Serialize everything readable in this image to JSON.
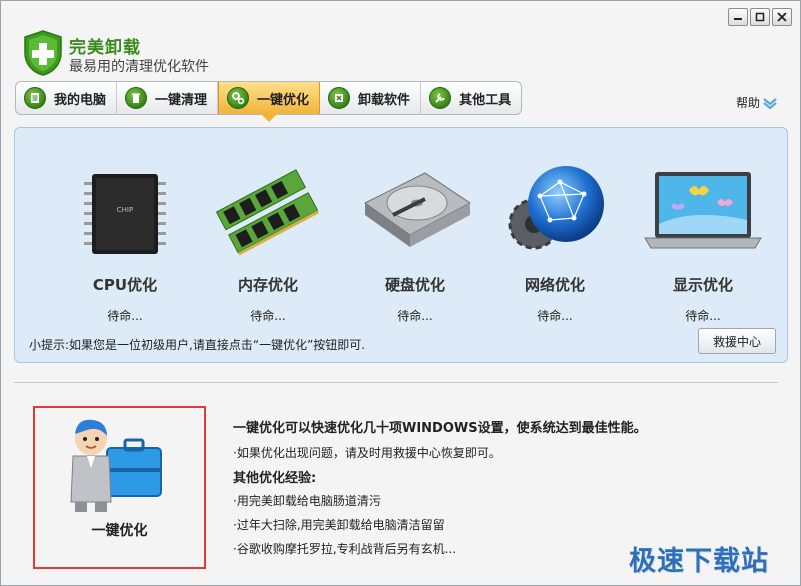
{
  "app": {
    "name": "完美卸载",
    "slogan": "最易用的清理优化软件"
  },
  "tabs": [
    {
      "label": "我的电脑",
      "icon": "document-icon"
    },
    {
      "label": "一键清理",
      "icon": "trash-icon"
    },
    {
      "label": "一键优化",
      "icon": "gears-icon",
      "active": true
    },
    {
      "label": "卸载软件",
      "icon": "uninstall-icon"
    },
    {
      "label": "其他工具",
      "icon": "tools-icon"
    }
  ],
  "help": {
    "label": "帮助"
  },
  "options": [
    {
      "title": "CPU优化",
      "status": "待命...",
      "chip_text": "CHIP"
    },
    {
      "title": "内存优化",
      "status": "待命..."
    },
    {
      "title": "硬盘优化",
      "status": "待命..."
    },
    {
      "title": "网络优化",
      "status": "待命..."
    },
    {
      "title": "显示优化",
      "status": "待命..."
    }
  ],
  "tip": "小提示:如果您是一位初级用户,请直接点击“一键优化”按钮即可.",
  "rescue_button": "救援中心",
  "onekey": {
    "label": "一键优化"
  },
  "info": {
    "headline": "一键优化可以快速优化几十项WINDOWS设置，使系统达到最佳性能。",
    "line1": "·如果优化出现问题，请及时用救援中心恢复即可。",
    "subhead": "其他优化经验:",
    "tips": [
      "·用完美卸载给电脑肠道清污",
      "·过年大扫除,用完美卸载给电脑清洁留留",
      "·谷歌收购摩托罗拉,专利战背后另有玄机..."
    ]
  },
  "watermark": "极速下载站",
  "colors": {
    "accent_green": "#3a8a1e",
    "active_tab": "#f1b33b",
    "panel_bg": "#dcebf7",
    "highlight_border": "#e03a3a"
  }
}
